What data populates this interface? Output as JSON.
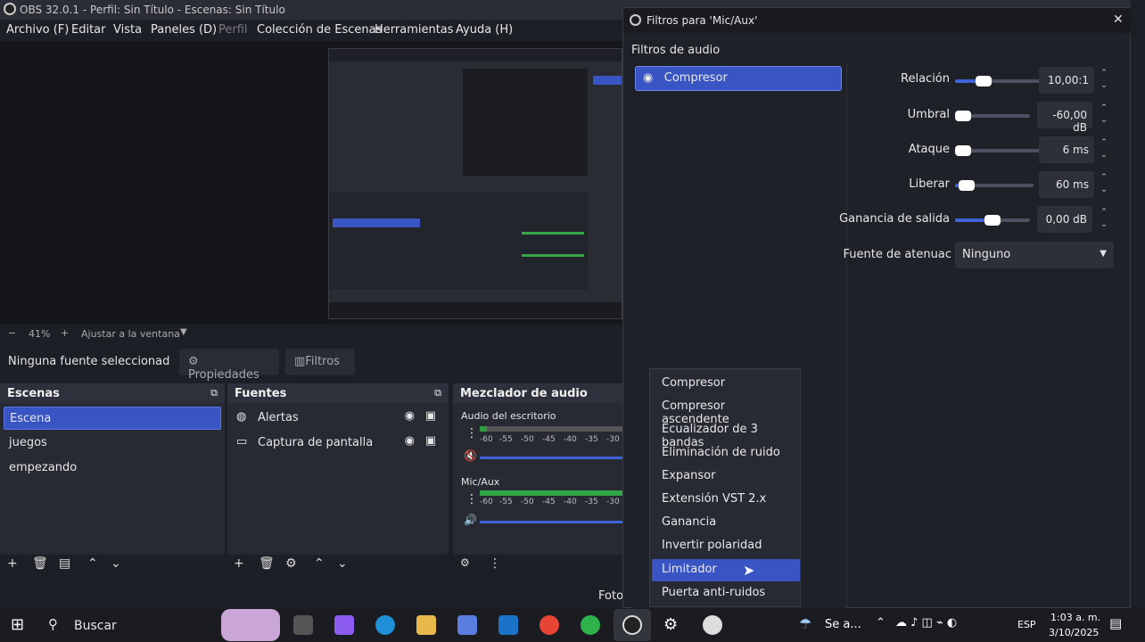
{
  "window": {
    "title": "OBS 32.0.1 - Perfil: Sin Título - Escenas: Sin Título"
  },
  "menu": [
    "Archivo (F)",
    "Editar",
    "Vista",
    "Paneles (D)",
    "Perfil",
    "Colección de Escenas",
    "Herramientas",
    "Ayuda (H)"
  ],
  "zoom": {
    "minus": "−",
    "value": "41%",
    "plus": "+",
    "fit": "Ajustar a la ventana",
    "caret": "▼"
  },
  "source_bar": {
    "status": "Ninguna fuente seleccionad",
    "properties": "Propiedades",
    "filters": "Filtros"
  },
  "scenes": {
    "title": "Escenas",
    "items": [
      "Escena",
      "juegos",
      "empezando"
    ],
    "selected": 0
  },
  "sources": {
    "title": "Fuentes",
    "items": [
      {
        "label": "Alertas",
        "icon": "globe-icon"
      },
      {
        "label": "Captura de pantalla",
        "icon": "monitor-icon"
      }
    ]
  },
  "mixer": {
    "title": "Mezclador de audio",
    "tracks": [
      {
        "name": "Audio del escritorio",
        "ticks": [
          "-60",
          "-55",
          "-50",
          "-45",
          "-40",
          "-35",
          "-30"
        ],
        "muted": true
      },
      {
        "name": "Mic/Aux",
        "ticks": [
          "-60",
          "-55",
          "-50",
          "-45",
          "-40",
          "-35",
          "-30"
        ],
        "muted": false
      }
    ]
  },
  "status": {
    "text": "Foto"
  },
  "dialog": {
    "title": "Filtros para 'Mic/Aux'",
    "section": "Filtros de audio",
    "filters": [
      "Compresor"
    ],
    "params": [
      {
        "label": "Relación",
        "value": "10,00:1",
        "level": 0.2
      },
      {
        "label": "Umbral",
        "value": "-60,00 dB",
        "level": 0.0
      },
      {
        "label": "Ataque",
        "value": "6 ms",
        "level": 0.0
      },
      {
        "label": "Liberar",
        "value": "60 ms",
        "level": 0.06
      },
      {
        "label": "Ganancia de salida",
        "value": "0,00 dB",
        "level": 0.5
      }
    ],
    "source_label": "Fuente de atenuac",
    "source_value": "Ninguno",
    "close": "✕"
  },
  "menu_popup": {
    "items": [
      "Compresor",
      "Compresor ascendente",
      "Ecualizador de 3 bandas",
      "Eliminación de ruido",
      "Expansor",
      "Extensión VST 2.x",
      "Ganancia",
      "Invertir polaridad",
      "Limitador",
      "Puerta anti-ruidos"
    ],
    "selected": 8
  },
  "taskbar": {
    "search": "Buscar",
    "weather": "Se a...",
    "lang": "ESP",
    "time": "1:03 a. m.",
    "date": "3/10/2025"
  },
  "colors": {
    "accent": "#3955c4",
    "bg": "#1d1f26",
    "panel": "#272a33"
  }
}
